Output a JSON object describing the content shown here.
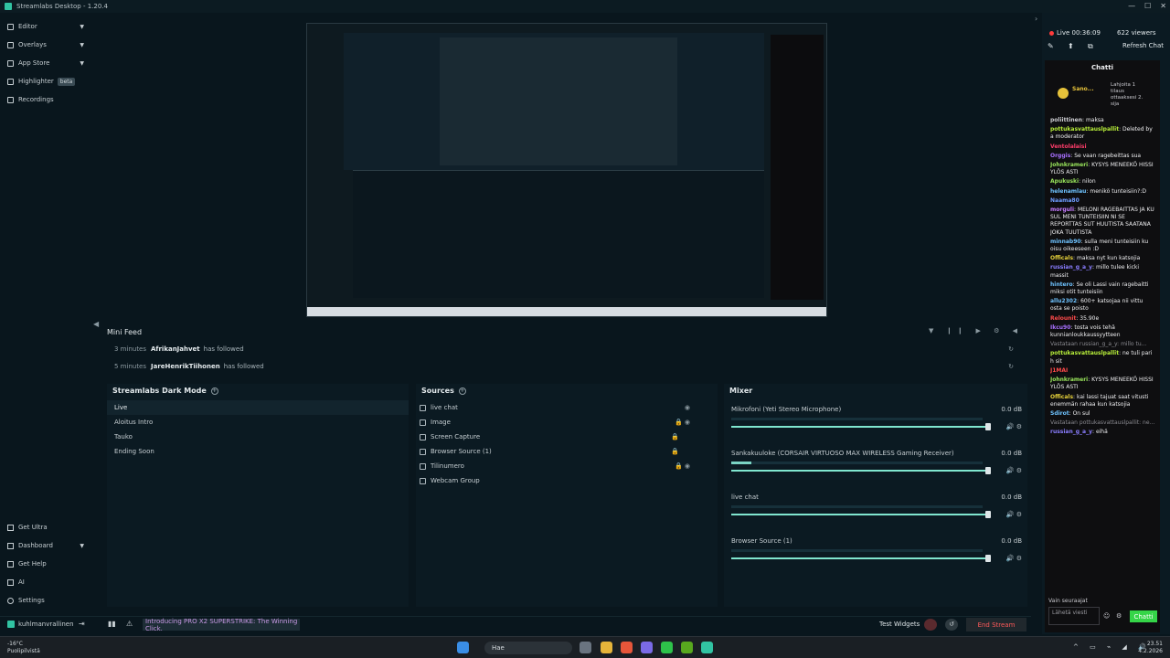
{
  "window": {
    "title": "Streamlabs Desktop - 1.20.4",
    "controls": [
      "—",
      "☐",
      "✕"
    ]
  },
  "sidebar": {
    "items": [
      {
        "label": "Editor",
        "icon": "editor-icon"
      },
      {
        "label": "Overlays",
        "icon": "overlays-icon"
      },
      {
        "label": "App Store",
        "icon": "app-store-icon"
      },
      {
        "label": "Highlighter",
        "icon": "highlighter-icon",
        "badge": "beta"
      },
      {
        "label": "Recordings",
        "icon": "recordings-icon"
      }
    ],
    "bottom_items": [
      {
        "label": "Get Ultra",
        "icon": "ultra-icon"
      },
      {
        "label": "Dashboard",
        "icon": "dashboard-icon"
      },
      {
        "label": "Get Help",
        "icon": "help-icon"
      },
      {
        "label": "AI",
        "icon": "ai-icon"
      },
      {
        "label": "Settings",
        "icon": "settings-icon"
      }
    ],
    "user": "kuhlmanvrallinen"
  },
  "mini_feed": {
    "title": "Mini Feed",
    "events": [
      {
        "time": "3 minutes",
        "user": "AfrikanJahvet",
        "action": "has followed"
      },
      {
        "time": "5 minutes",
        "user": "JareHenrikTiihonen",
        "action": "has followed"
      }
    ]
  },
  "scenes": {
    "title": "Streamlabs Dark Mode",
    "items": [
      "Live",
      "Aloitus Intro",
      "Tauko",
      "Ending Soon"
    ],
    "active": "Live"
  },
  "sources": {
    "title": "Sources",
    "items": [
      {
        "label": "live chat",
        "icon": "browser-icon"
      },
      {
        "label": "Image",
        "icon": "image-icon"
      },
      {
        "label": "Screen Capture",
        "icon": "screen-icon"
      },
      {
        "label": "Browser Source (1)",
        "icon": "browser-icon"
      },
      {
        "label": "Tilinumero",
        "icon": "text-icon"
      },
      {
        "label": "Webcam Group",
        "icon": "folder-icon"
      }
    ]
  },
  "mixer": {
    "title": "Mixer",
    "channels": [
      {
        "name": "Mikrofoni (Yeti Stereo Microphone)",
        "db": "0.0 dB",
        "level": 0.0
      },
      {
        "name": "Sankakuuloke (CORSAIR VIRTUOSO MAX WIRELESS Gaming Receiver)",
        "db": "0.0 dB",
        "level": 0.08
      },
      {
        "name": "live chat",
        "db": "0.0 dB",
        "level": 0.0
      },
      {
        "name": "Browser Source (1)",
        "db": "0.0 dB",
        "level": 0.0
      }
    ]
  },
  "footer": {
    "promo": "Introducing PRO X2 SUPERSTRIKE: The Winning Click.",
    "test_widgets": "Test Widgets",
    "end_stream": "End Stream"
  },
  "stream": {
    "status": "Live 00:36:09",
    "viewers": "622 viewers",
    "refresh": "Refresh Chat"
  },
  "chat": {
    "title": "Chatti",
    "gift": "Lahjoita 1 tilaus ottaaksesi 2. sija",
    "gift_user": "Sano...",
    "messages": [
      {
        "user": "poliittinen",
        "text": "maksa",
        "color": "#cfcfd4"
      },
      {
        "user": "pottukasvattauslpallit",
        "text": "Deleted by a moderator",
        "color": "#b9f03a"
      },
      {
        "user": "Ventolalaisi",
        "text": "",
        "color": "#ff3d6a"
      },
      {
        "user": "Orggis",
        "text": "Se vaan ragebeittas sua",
        "color": "#a970ff"
      },
      {
        "user": "Johnkrameri",
        "text": "KYSYS MENEEKÖ HISSI YLÖS ASTI",
        "color": "#9ae65c"
      },
      {
        "user": "Apukuski",
        "text": "nilon",
        "color": "#9ae65c"
      },
      {
        "user": "helenamlau",
        "text": "menikö tunteisiin?:D",
        "color": "#6fc3ff"
      },
      {
        "user": "Naama80",
        "text": "",
        "color": "#6f9dff"
      },
      {
        "user": "morguli",
        "text": "MELONI RAGEBAITTAS JA KU SUL MENI TUNTEISIIN NI SE REPORTTAS SUT HUUTISTA SAATANA JOKA TUUTISTA",
        "color": "#c77dff"
      },
      {
        "user": "minnab90",
        "text": "sulla meni tunteisiin ku oisu oikeeseen :D",
        "color": "#6fc3ff"
      },
      {
        "user": "Officals",
        "text": "maksa nyt kun katsojia",
        "color": "#e6d13a"
      },
      {
        "user": "russian_g_a_y",
        "text": "millo tulee kicki massit",
        "color": "#8a7dff"
      },
      {
        "user": "hintero",
        "text": "Se oli Lassi vain ragebaitti miksi otit tunteisiin",
        "color": "#6fc3ff"
      },
      {
        "user": "allu2302",
        "text": "600+ katsojaa nii vittu osta se poisto",
        "color": "#6fc3ff"
      },
      {
        "user": "Relounit",
        "text": "35.90e",
        "color": "#ff4a4a"
      },
      {
        "user": "Ikcu90",
        "text": "tosta vois tehä kunnianloukkaussyytteen",
        "color": "#a970ff"
      },
      {
        "user": "",
        "text": "Vastataan russian_g_a_y: millo tu...",
        "color": "#8a8a90",
        "sys": true
      },
      {
        "user": "pottukasvattauslpallit",
        "text": "ne tuli pari h sit",
        "color": "#b9f03a"
      },
      {
        "user": "J1MAI",
        "text": "",
        "color": "#ff4a4a"
      },
      {
        "user": "Johnkrameri",
        "text": "KYSYS MENEEKÖ HISSI YLÖS ASTI",
        "color": "#9ae65c"
      },
      {
        "user": "Officals",
        "text": "kai lassi tajuat saat vitusti enemmän rahaa kun katsojia",
        "color": "#e6d13a"
      },
      {
        "user": "Sdirot",
        "text": "On sul",
        "color": "#6fc3ff"
      },
      {
        "user": "",
        "text": "Vastataan pottukasvattauslpallit: ne...",
        "color": "#8a8a90",
        "sys": true
      },
      {
        "user": "russian_g_a_y",
        "text": "eihä",
        "color": "#8a7dff"
      }
    ],
    "followers_only": "Vain seuraajat",
    "input_placeholder": "Lähetä viesti",
    "send_label": "Chatti"
  },
  "taskbar": {
    "weather": "-16°C",
    "weather_desc": "Puolipilvistä",
    "search": "Hae",
    "time": "23.51",
    "date": "4.2.2026"
  }
}
